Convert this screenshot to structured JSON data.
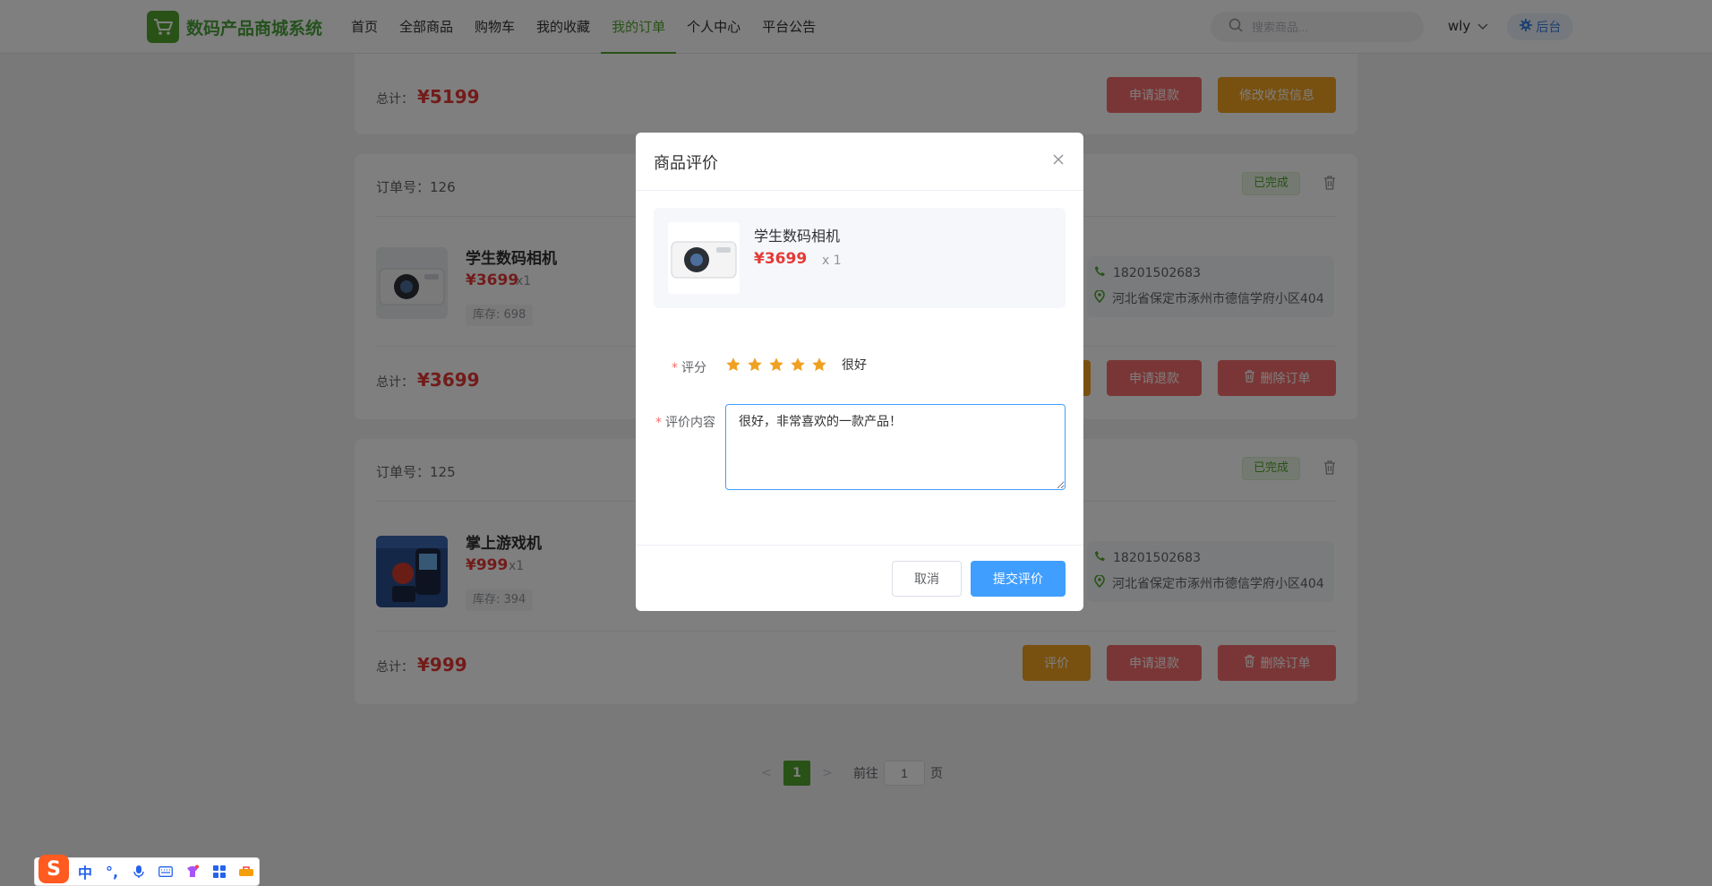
{
  "header": {
    "logo_text": "数码产品商城系统",
    "nav": [
      "首页",
      "全部商品",
      "购物车",
      "我的收藏",
      "我的订单",
      "个人中心",
      "平台公告"
    ],
    "active_nav": "我的订单",
    "search_placeholder": "搜索商品...",
    "username": "wly",
    "admin_label": "后台"
  },
  "top_card": {
    "total_label": "总计：",
    "total_value": "¥5199",
    "refund_btn": "申请退款",
    "edit_addr_btn": "修改收货信息"
  },
  "orders": [
    {
      "order_no_label": "订单号：126",
      "status": "已完成",
      "product_name": "学生数码相机",
      "price": "¥3699",
      "qty": "x1",
      "stock": "库存: 698",
      "phone": "18201502683",
      "address": "河北省保定市涿州市德信学府小区404",
      "total_label": "总计：",
      "total_value": "¥3699",
      "refund_btn": "申请退款",
      "delete_btn": "删除订单"
    },
    {
      "order_no_label": "订单号：125",
      "status": "已完成",
      "product_name": "掌上游戏机",
      "price": "¥999",
      "qty": "x1",
      "stock": "库存: 394",
      "phone": "18201502683",
      "address": "河北省保定市涿州市德信学府小区404",
      "total_label": "总计：",
      "total_value": "¥999",
      "review_btn": "评价",
      "refund_btn": "申请退款",
      "delete_btn": "删除订单"
    }
  ],
  "pagination": {
    "current": "1",
    "goto_label": "前往",
    "goto_value": "1",
    "page_suffix": "页"
  },
  "dialog": {
    "title": "商品评价",
    "product_name": "学生数码相机",
    "price": "¥3699",
    "qty": "x 1",
    "rating_label": "评分",
    "rating_value": 5,
    "rating_max": 5,
    "rating_text": "很好",
    "content_label": "评价内容",
    "content_value": "很好，非常喜欢的一款产品！",
    "cancel_btn": "取消",
    "submit_btn": "提交评价"
  },
  "ime": {
    "mode": "中"
  },
  "colors": {
    "brand_green": "#52a52e",
    "danger": "#f56c6c",
    "warning": "#f0a020",
    "primary": "#409eff",
    "price_red": "#e53935"
  }
}
